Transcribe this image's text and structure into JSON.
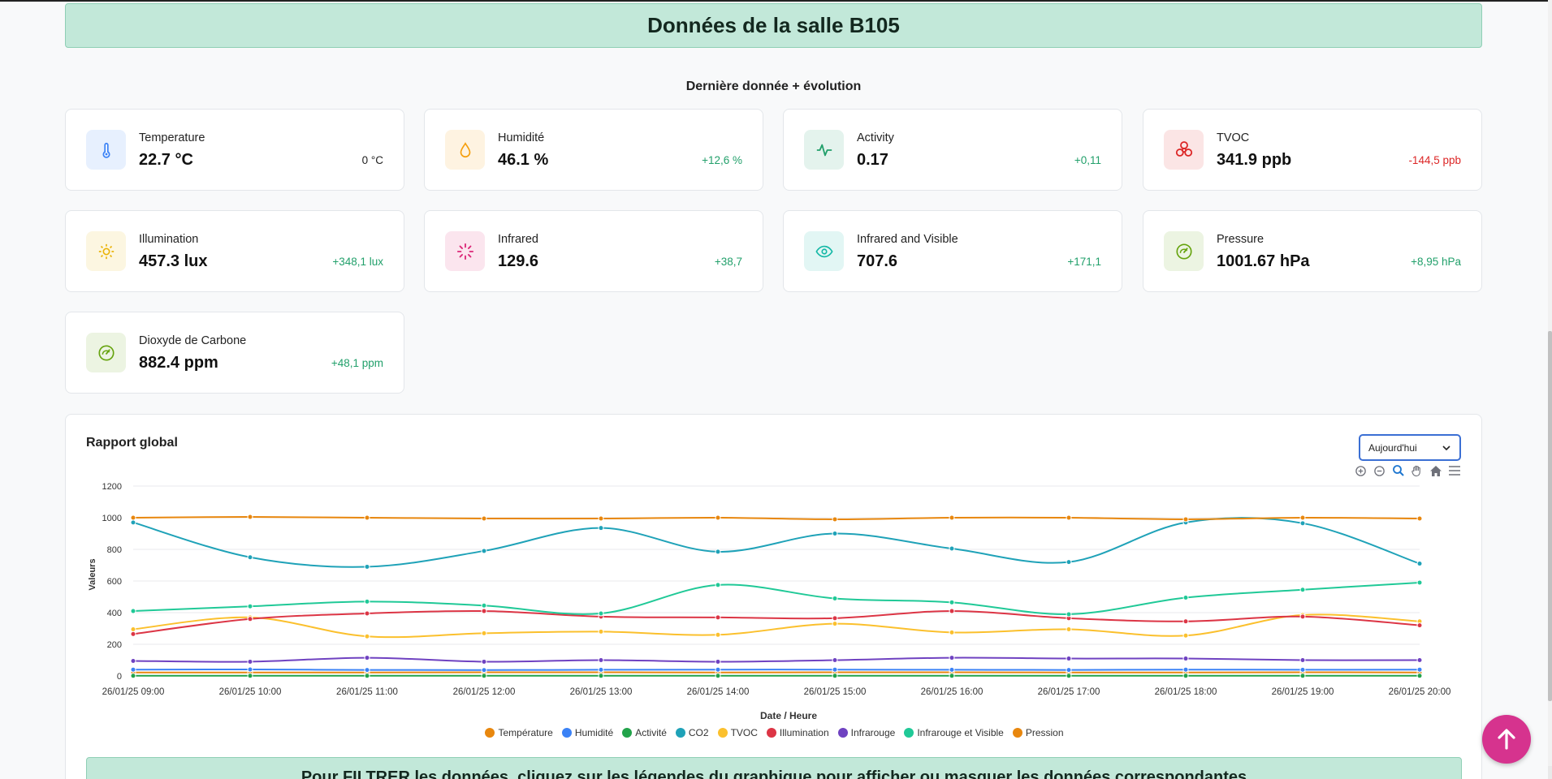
{
  "page": {
    "banner": "Données de la salle B105",
    "subtitle": "Dernière donnée + évolution"
  },
  "cards": [
    {
      "label": "Temperature",
      "value": "22.7 °C",
      "delta": "0 °C",
      "trend": "neutral",
      "icon": "thermometer-icon",
      "accent": "#3b82f6"
    },
    {
      "label": "Humidité",
      "value": "46.1 %",
      "delta": "+12,6 %",
      "trend": "up",
      "icon": "droplet-icon",
      "accent": "#f59e0b"
    },
    {
      "label": "Activity",
      "value": "0.17",
      "delta": "+0,11",
      "trend": "up",
      "icon": "activity-icon",
      "accent": "#22a06b"
    },
    {
      "label": "TVOC",
      "value": "341.9 ppb",
      "delta": "-144,5 ppb",
      "trend": "down",
      "icon": "biohazard-icon",
      "accent": "#dc2626"
    },
    {
      "label": "Illumination",
      "value": "457.3 lux",
      "delta": "+348,1 lux",
      "trend": "up",
      "icon": "sun-icon",
      "accent": "#eab308"
    },
    {
      "label": "Infrared",
      "value": "129.6",
      "delta": "+38,7",
      "trend": "up",
      "icon": "loader-icon",
      "accent": "#db2777"
    },
    {
      "label": "Infrared and Visible",
      "value": "707.6",
      "delta": "+171,1",
      "trend": "up",
      "icon": "eye-icon",
      "accent": "#14b8a6"
    },
    {
      "label": "Pressure",
      "value": "1001.67 hPa",
      "delta": "+8,95 hPa",
      "trend": "up",
      "icon": "gauge-icon",
      "accent": "#65a30d"
    },
    {
      "label": "Dioxyde de Carbone",
      "value": "882.4 ppm",
      "delta": "+48,1 ppm",
      "trend": "up",
      "icon": "gauge-icon",
      "accent": "#65a30d"
    }
  ],
  "colors": {
    "up": "#22a06b",
    "down": "#dc2626",
    "neutral": "#222222"
  },
  "report": {
    "title": "Rapport global",
    "period_select": "Aujourd'hui",
    "filter_note": "Pour FILTRER les données, cliquez sur les légendes du graphique pour afficher ou masquer les données correspondantes"
  },
  "chart_data": {
    "type": "line",
    "xlabel": "Date / Heure",
    "ylabel": "Valeurs",
    "ylim": [
      0,
      1200
    ],
    "yticks": [
      0,
      200,
      400,
      600,
      800,
      1000,
      1200
    ],
    "grid": true,
    "legend_position": "bottom",
    "x": [
      "26/01/25 09:00",
      "26/01/25 10:00",
      "26/01/25 11:00",
      "26/01/25 12:00",
      "26/01/25 13:00",
      "26/01/25 14:00",
      "26/01/25 15:00",
      "26/01/25 16:00",
      "26/01/25 17:00",
      "26/01/25 18:00",
      "26/01/25 19:00",
      "26/01/25 20:00"
    ],
    "series": [
      {
        "name": "Température",
        "color": "#e8870e",
        "values": [
          22,
          22,
          22,
          23,
          23,
          22,
          23,
          23,
          22,
          22,
          23,
          22
        ]
      },
      {
        "name": "Humidité",
        "color": "#3b82f6",
        "values": [
          40,
          41,
          38,
          37,
          39,
          40,
          40,
          39,
          38,
          40,
          39,
          40
        ]
      },
      {
        "name": "Activité",
        "color": "#22a34a",
        "values": [
          1,
          1,
          1,
          1,
          1,
          1,
          1,
          1,
          1,
          1,
          1,
          1
        ]
      },
      {
        "name": "CO2",
        "color": "#1fa2b8",
        "values": [
          970,
          750,
          690,
          790,
          935,
          785,
          900,
          805,
          720,
          970,
          965,
          710
        ]
      },
      {
        "name": "TVOC",
        "color": "#fbc02d",
        "values": [
          295,
          370,
          250,
          270,
          280,
          260,
          330,
          275,
          295,
          255,
          385,
          345
        ]
      },
      {
        "name": "Illumination",
        "color": "#dc3545",
        "values": [
          265,
          360,
          395,
          410,
          375,
          370,
          365,
          410,
          365,
          345,
          375,
          320
        ]
      },
      {
        "name": "Infrarouge",
        "color": "#6f42c1",
        "values": [
          95,
          90,
          115,
          90,
          100,
          90,
          100,
          115,
          110,
          110,
          100,
          100
        ]
      },
      {
        "name": "Infrarouge et Visible",
        "color": "#20c997",
        "values": [
          410,
          440,
          470,
          445,
          395,
          575,
          490,
          465,
          390,
          495,
          545,
          590
        ]
      },
      {
        "name": "Pression",
        "color": "#e8870e",
        "values": [
          1000,
          1005,
          1000,
          995,
          995,
          1000,
          990,
          1000,
          1000,
          990,
          1000,
          995
        ]
      }
    ]
  }
}
